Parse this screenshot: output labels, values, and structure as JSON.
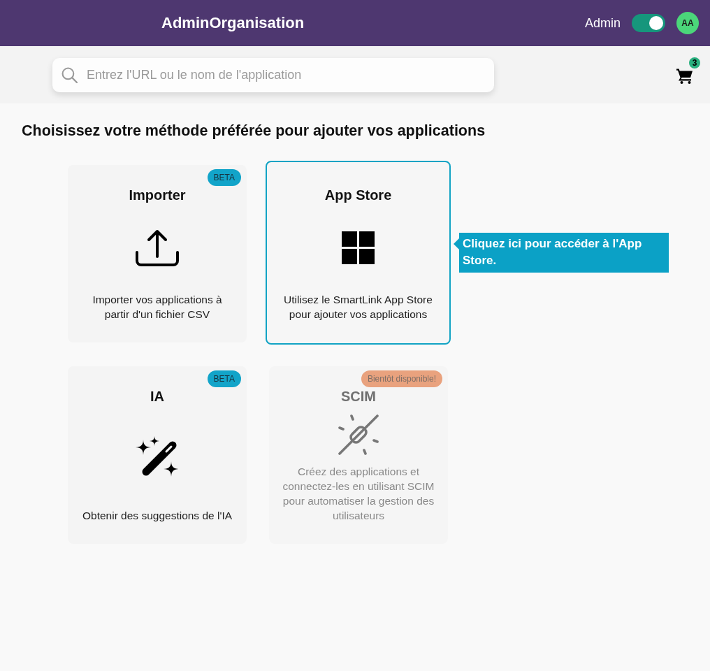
{
  "header": {
    "title": "AdminOrganisation",
    "user_label": "Admin",
    "admin_toggle": {
      "on": true
    },
    "avatar": {
      "initials": "AA"
    }
  },
  "search": {
    "placeholder": "Entrez l'URL ou le nom de l'application"
  },
  "cart": {
    "count": "3"
  },
  "heading": "Choisissez votre méthode préférée pour ajouter vos applications",
  "methods": [
    {
      "kind": "upload",
      "title": "Importer",
      "description": "Importer vos applications à partir d'un fichier CSV",
      "badge": {
        "text": "BETA",
        "color": "#12a4c9"
      },
      "selected": false,
      "disabled": false
    },
    {
      "kind": "grid",
      "title": "App Store",
      "description": "Utilisez le SmartLink App Store pour ajouter vos applications",
      "selected": true,
      "disabled": false
    },
    {
      "kind": "wand",
      "title": "IA",
      "description": "Obtenir des suggestions de l'IA",
      "badge": {
        "text": "BETA",
        "color": "#12a4c9"
      },
      "selected": false,
      "disabled": false
    },
    {
      "kind": "plug",
      "title": "SCIM",
      "description": "Créez des applications et connectez-les en utilisant SCIM pour automatiser la gestion des utilisateurs",
      "badge": {
        "text": "Bientôt disponible!",
        "color": "#e9a27e"
      },
      "selected": false,
      "disabled": true
    }
  ],
  "tooltip": {
    "text": "Cliquez ici pour accéder à l'App Store."
  }
}
